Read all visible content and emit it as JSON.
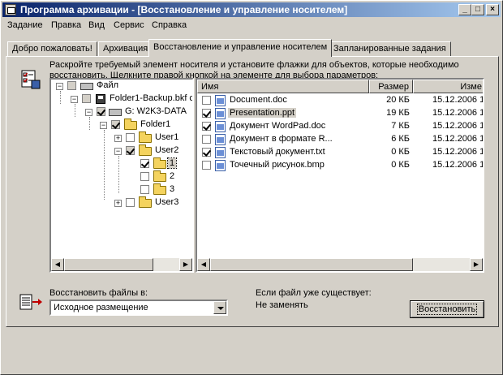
{
  "window": {
    "title": "Программа архивации - [Восстановление и управление носителем]",
    "controls": {
      "minimize": "_",
      "maximize": "□",
      "close": "×"
    }
  },
  "menu": [
    {
      "label": "Задание",
      "accel": "З"
    },
    {
      "label": "Правка",
      "accel": "П"
    },
    {
      "label": "Вид",
      "accel": "В"
    },
    {
      "label": "Сервис",
      "accel": "С"
    },
    {
      "label": "Справка",
      "accel": "р"
    }
  ],
  "tabs": [
    {
      "label": "Добро пожаловать!",
      "active": false
    },
    {
      "label": "Архивация",
      "active": false
    },
    {
      "label": "Восстановление и управление носителем",
      "active": true
    },
    {
      "label": "Запланированные задания",
      "active": false
    }
  ],
  "instruction": "Раскройте требуемый элемент носителя и установите флажки для объектов, которые необходимо восстановить. Щелкните правой кнопкой на элементе для выбора параметров:",
  "tree": [
    {
      "label": "Файл",
      "expanded": true,
      "checked": false
    },
    {
      "label": "Folder1-Backup.bkf с",
      "expanded": true,
      "checked": false
    },
    {
      "label": "G: W2K3-DATA",
      "expanded": true,
      "checked": true
    },
    {
      "label": "Folder1",
      "expanded": true,
      "checked": true
    },
    {
      "label": "User1",
      "expanded": false,
      "checked": false
    },
    {
      "label": "User2",
      "expanded": true,
      "checked": true
    },
    {
      "label": "1",
      "checked": true,
      "selected": true
    },
    {
      "label": "2",
      "checked": false
    },
    {
      "label": "3",
      "checked": false
    },
    {
      "label": "User3",
      "expanded": false,
      "checked": false
    }
  ],
  "list": {
    "columns": [
      "Имя",
      "Размер",
      "Изме"
    ],
    "rows": [
      {
        "name": "Document.doc",
        "size": "20 КБ",
        "modified": "15.12.2006 1",
        "checked": false,
        "selected": false
      },
      {
        "name": "Presentation.ppt",
        "size": "19 КБ",
        "modified": "15.12.2006 1",
        "checked": true,
        "selected": true
      },
      {
        "name": "Документ WordPad.doc",
        "size": "7 КБ",
        "modified": "15.12.2006 1",
        "checked": true,
        "selected": false
      },
      {
        "name": "Документ в формате R...",
        "size": "6 КБ",
        "modified": "15.12.2006 1",
        "checked": false,
        "selected": false
      },
      {
        "name": "Текстовый документ.txt",
        "size": "0 КБ",
        "modified": "15.12.2006 1",
        "checked": true,
        "selected": false
      },
      {
        "name": "Точечный рисунок.bmp",
        "size": "0 КБ",
        "modified": "15.12.2006 1",
        "checked": false,
        "selected": false
      }
    ]
  },
  "restore": {
    "label": "Восстановить файлы в:",
    "location": "Исходное размещение",
    "exists_label": "Если файл уже существует:",
    "exists_value": "Не заменять",
    "button": "Восстановить"
  }
}
